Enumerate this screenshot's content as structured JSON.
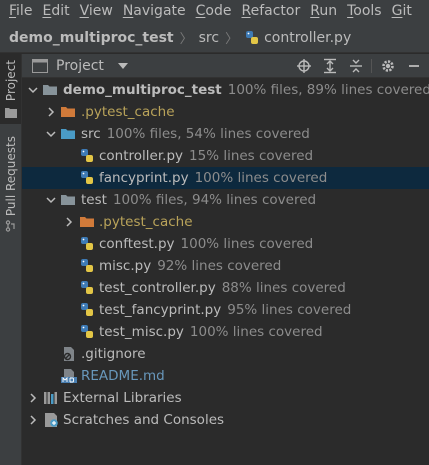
{
  "menubar": {
    "items": [
      {
        "first": "F",
        "rest": "ile"
      },
      {
        "first": "E",
        "rest": "dit"
      },
      {
        "first": "V",
        "rest": "iew"
      },
      {
        "first": "N",
        "rest": "avigate"
      },
      {
        "first": "C",
        "rest": "ode"
      },
      {
        "first": "R",
        "rest": "efactor"
      },
      {
        "first": "R",
        "rest": "un"
      },
      {
        "first": "T",
        "rest": "ools"
      },
      {
        "first": "G",
        "rest": "it"
      }
    ]
  },
  "navbar": {
    "project": "demo_multiproc_test",
    "folder": "src",
    "file": "controller.py"
  },
  "leftstrip": {
    "project_tab": "Project",
    "pull_requests_tab": "Pull Requests"
  },
  "panel": {
    "title": "Project"
  },
  "tree": {
    "root": {
      "name": "demo_multiproc_test",
      "coverage": "100% files, 89% lines covered"
    },
    "pytest_cache_root": {
      "name": ".pytest_cache"
    },
    "src": {
      "name": "src",
      "coverage": "100% files, 54% lines covered"
    },
    "controller": {
      "name": "controller.py",
      "coverage": "15% lines covered"
    },
    "fancyprint": {
      "name": "fancyprint.py",
      "coverage": "100% lines covered"
    },
    "test": {
      "name": "test",
      "coverage": "100% files, 94% lines covered"
    },
    "pytest_cache_test": {
      "name": ".pytest_cache"
    },
    "conftest": {
      "name": "conftest.py",
      "coverage": "100% lines covered"
    },
    "misc": {
      "name": "misc.py",
      "coverage": "92% lines covered"
    },
    "test_controller": {
      "name": "test_controller.py",
      "coverage": "88% lines covered"
    },
    "test_fancyprint": {
      "name": "test_fancyprint.py",
      "coverage": "95% lines covered"
    },
    "test_misc": {
      "name": "test_misc.py",
      "coverage": "100% lines covered"
    },
    "gitignore": {
      "name": ".gitignore"
    },
    "readme": {
      "name": "README.md"
    },
    "external_libraries": {
      "name": "External Libraries"
    },
    "scratches": {
      "name": "Scratches and Consoles"
    }
  },
  "colors": {
    "background": "#2b2b2b",
    "chrome": "#3c3f41",
    "selection": "#0d293e",
    "folder": "#87939a",
    "source_folder": "#4a9bc6",
    "excluded_text": "#b9a35a",
    "markdown_text": "#6897bb"
  }
}
